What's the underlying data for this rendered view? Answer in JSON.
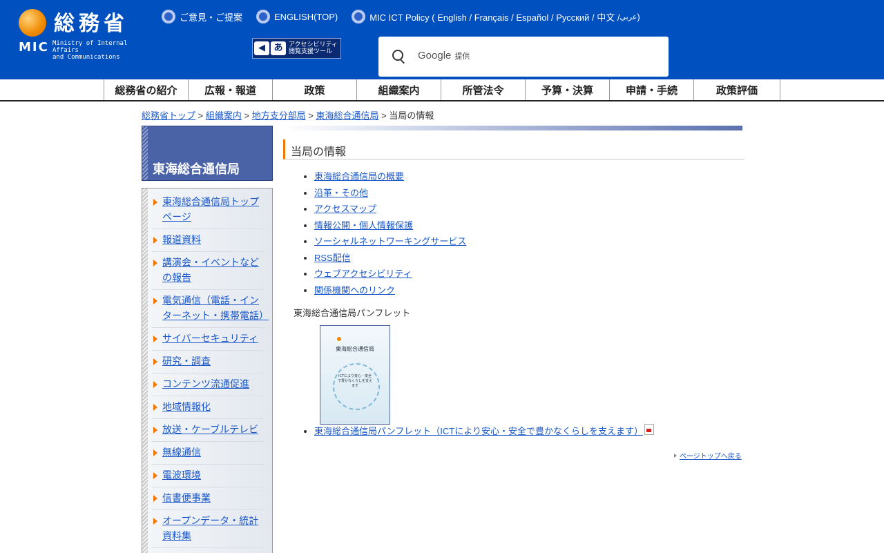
{
  "header": {
    "logo_text": "総務省",
    "logo_abbr": "MIC",
    "logo_sub_1": "Ministry of Internal Affairs",
    "logo_sub_2": "and Communications",
    "top_links": [
      "ご意見・ご提案",
      "ENGLISH(TOP)",
      "MIC ICT Policy ( English / Français / Español / Русский / 中文 / "
    ],
    "top_links_arabic": "عربي",
    "top_links_close": " )",
    "accessibility_tool_1": "アクセシビリティ",
    "accessibility_tool_2": "閲覧支援ツール",
    "search_brand": "Google",
    "search_brand_suffix": "提供"
  },
  "nav": [
    "総務省の紹介",
    "広報・報道",
    "政策",
    "組織案内",
    "所管法令",
    "予算・決算",
    "申請・手続",
    "政策評価"
  ],
  "breadcrumb": {
    "items": [
      "総務省トップ",
      "組織案内",
      "地方支分部局",
      "東海総合通信局"
    ],
    "separator": " > ",
    "current": "当局の情報"
  },
  "sidebar": {
    "title": "東海総合通信局",
    "items": [
      "東海総合通信局トップページ",
      "報道資料",
      "講演会・イベントなどの報告",
      "電気通信（電話・インターネット・携帯電話）",
      "サイバーセキュリティ",
      "研究・調査",
      "コンテンツ流通促進",
      "地域情報化",
      "放送・ケーブルテレビ",
      "無線通信",
      "電波環境",
      "信書便事業",
      "オープンデータ・統計資料集"
    ]
  },
  "main": {
    "heading": "当局の情報",
    "links": [
      "東海総合通信局の概要",
      "沿革・その他",
      "アクセスマップ",
      "情報公開・個人情報保護",
      "ソーシャルネットワーキングサービス",
      "RSS配信",
      "ウェブアクセシビリティ",
      "関係機関へのリンク"
    ],
    "pamphlet_label": "東海総合通信局パンフレット",
    "pamphlet_cover_title": "東海総合通信局",
    "pamphlet_cover_text": "ICTにより安心・安全で豊かなくらしを支えます",
    "pamphlet_link": "東海総合通信局パンフレット（ICTにより安心・安全で豊かなくらしを支えます）",
    "page_top": "ページトップへ戻る"
  },
  "colors": {
    "header_bg": "#0050c0",
    "accent": "#f07800",
    "link": "#1a57c9",
    "side_header": "#4a62a6"
  }
}
